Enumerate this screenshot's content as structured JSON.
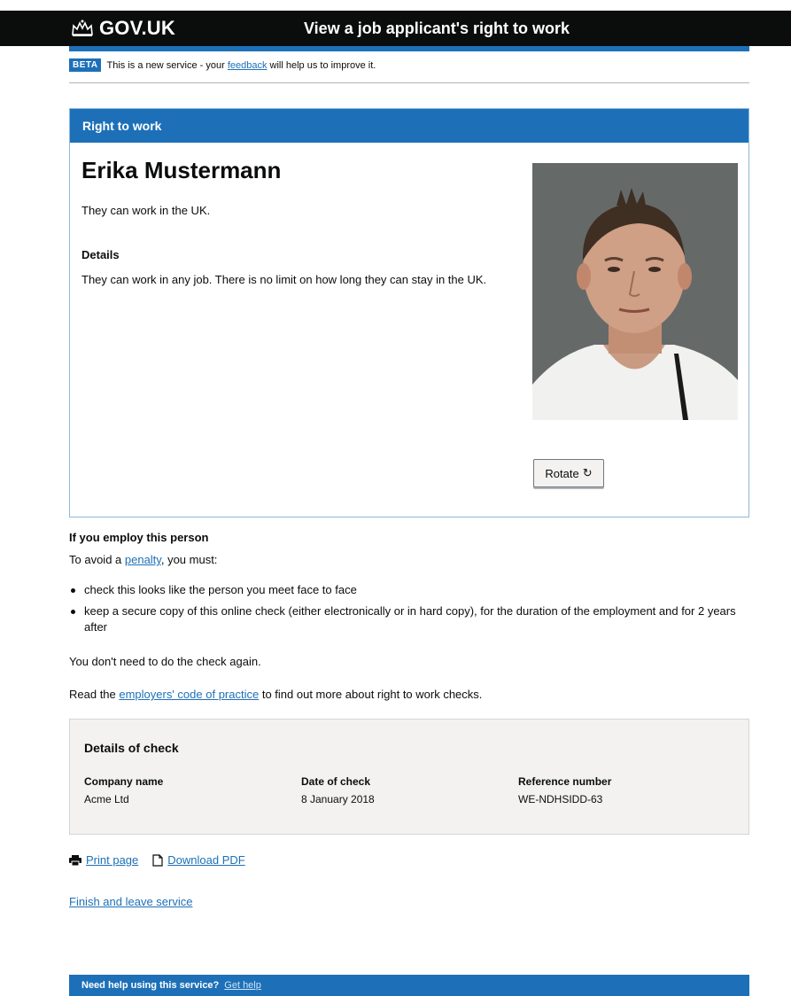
{
  "header": {
    "logo_text": "GOV.UK",
    "service_name": "View a job applicant's right to work"
  },
  "phase_banner": {
    "tag": "BETA",
    "text_before": "This is a new service - your ",
    "link": "feedback",
    "text_after": " will help us to improve it."
  },
  "panel": {
    "title": "Right to work",
    "name": "Erika Mustermann",
    "status": "They can work in the UK.",
    "details_heading": "Details",
    "details_text": "They can work in any job. There is no limit on how long they can stay in the UK.",
    "rotate_label": "Rotate"
  },
  "guidance": {
    "heading": "If you employ this person",
    "avoid_before": "To avoid a ",
    "avoid_link": "penalty",
    "avoid_after": ", you must:",
    "bullets": [
      "check this looks like the person you meet face to face",
      "keep a secure copy of this online check (either electronically or in hard copy), for the duration of the employment and for 2 years after"
    ],
    "no_need": "You don't need to do the check again.",
    "read_before": "Read the ",
    "read_link": "employers' code of practice",
    "read_after": " to find out more about right to work checks."
  },
  "check": {
    "title": "Details of check",
    "company_label": "Company name",
    "company_value": "Acme Ltd",
    "date_label": "Date of check",
    "date_value": "8 January 2018",
    "ref_label": "Reference number",
    "ref_value": "WE-NDHSIDD-63"
  },
  "actions": {
    "print_label": "Print page",
    "download_label": "Download PDF",
    "finish_label": "Finish and leave service"
  },
  "help": {
    "label": "Need help using this service?",
    "link": "Get help"
  },
  "colors": {
    "brand_blue": "#1d70b8",
    "header_black": "#0b0c0c",
    "panel_grey": "#f3f2f1"
  }
}
